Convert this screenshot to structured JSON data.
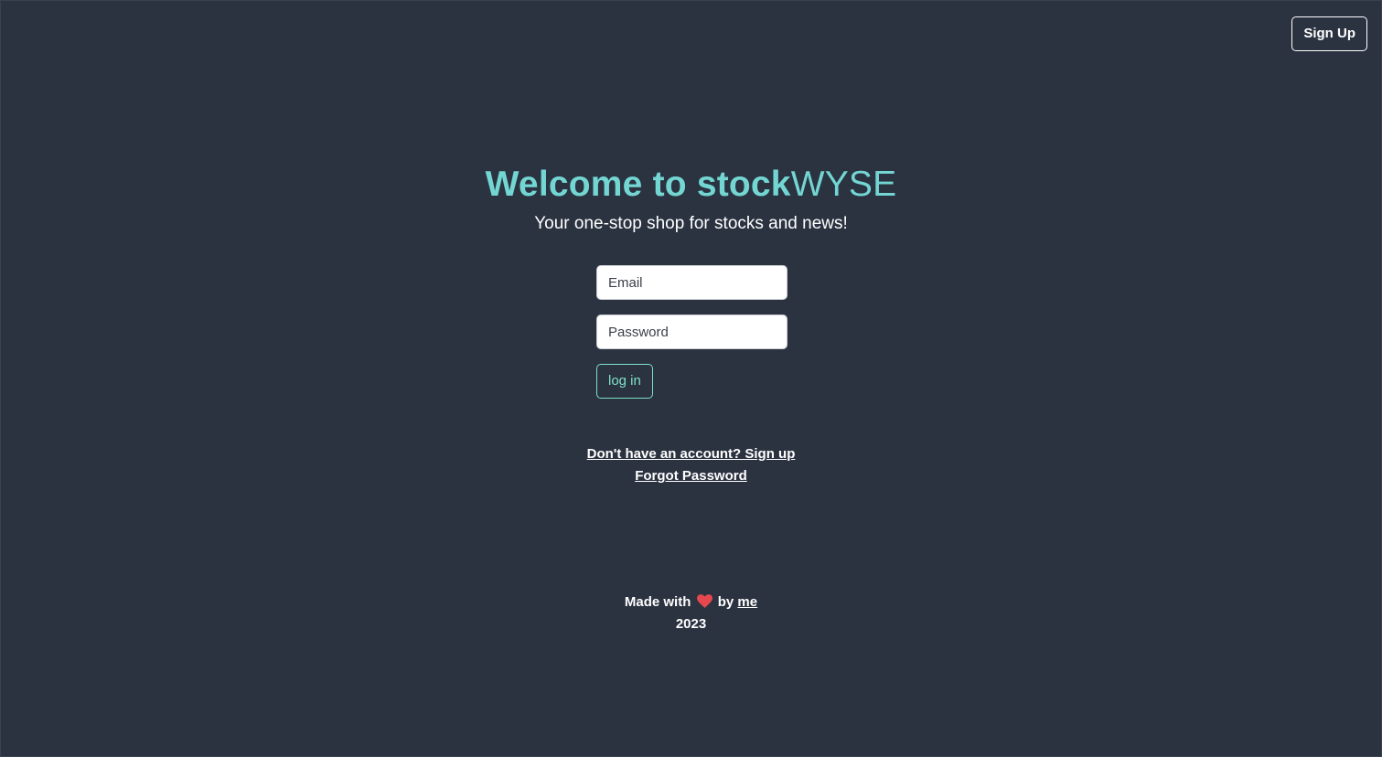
{
  "header": {
    "signup_label": "Sign Up"
  },
  "hero": {
    "title_bold": "Welcome to stock",
    "title_light": "WYSE",
    "subtitle": "Your one-stop shop for stocks and news!"
  },
  "form": {
    "email_placeholder": "Email",
    "password_placeholder": "Password",
    "login_label": "log in"
  },
  "links": {
    "signup_link": "Don't have an account? Sign up",
    "forgot_link": "Forgot Password"
  },
  "footer": {
    "made_with": "Made with",
    "heart_icon": "heart-icon",
    "by": "by",
    "me_link": "me",
    "year": "2023"
  },
  "colors": {
    "background": "#2b3240",
    "accent": "#73d6d3",
    "button_outline": "#7ee3c8",
    "heart": "#e5484d"
  }
}
